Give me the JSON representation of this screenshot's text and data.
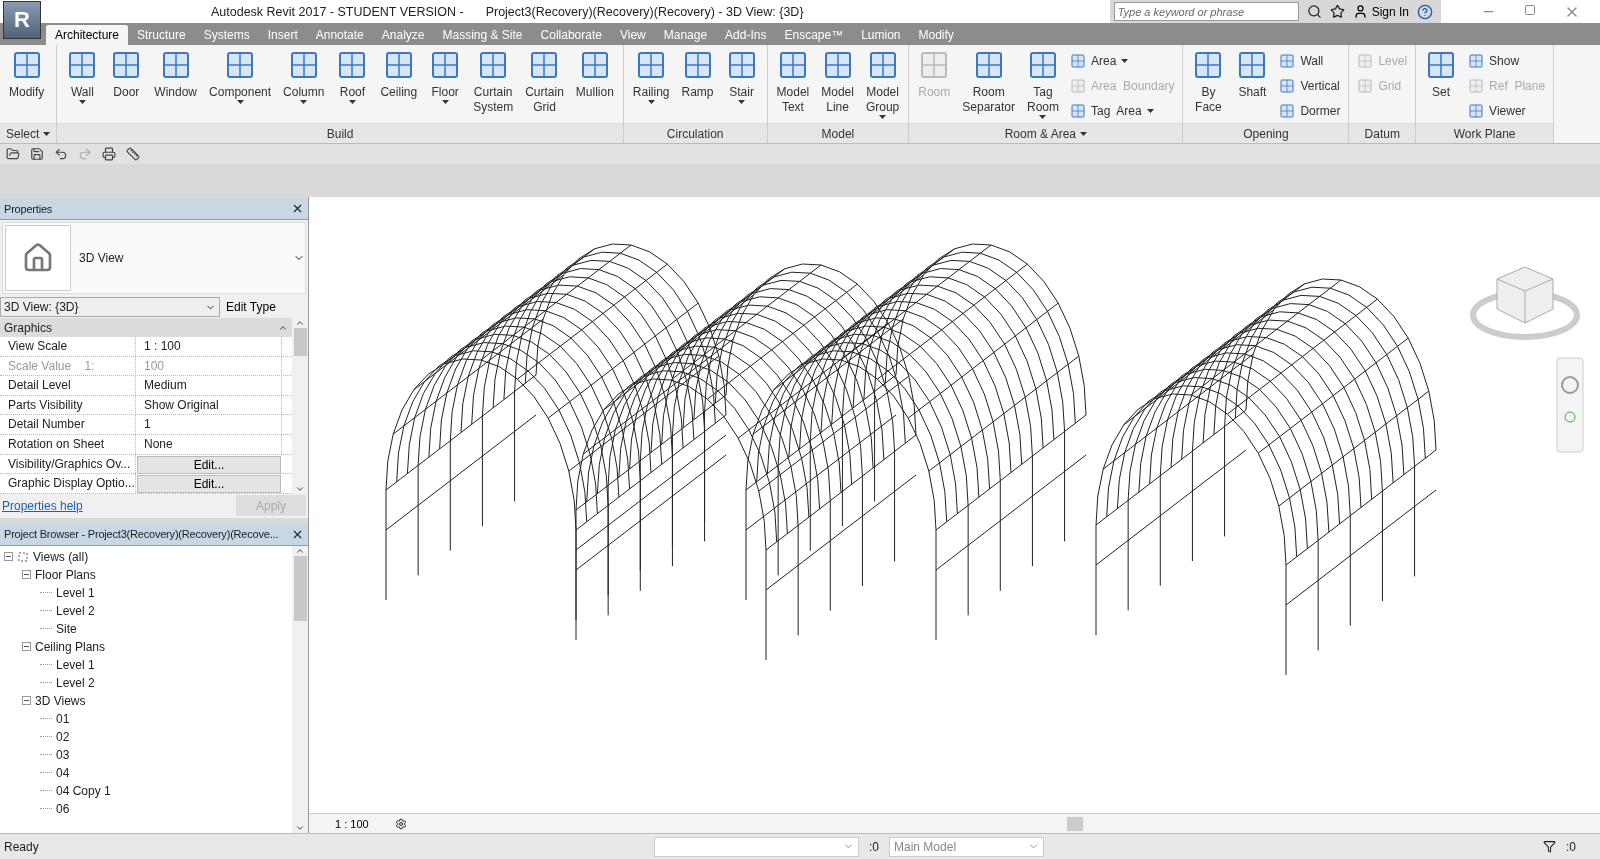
{
  "app_button": {
    "label": "R"
  },
  "title_bar": {
    "title": "Autodesk Revit 2017 - STUDENT VERSION -",
    "document": "Project3(Recovery)(Recovery)(Recovery) - 3D View: {3D}",
    "search": {
      "placeholder": "Type a keyword or phrase"
    },
    "sign_in": "Sign In"
  },
  "ribbon_tabs": [
    {
      "label": "Architecture",
      "selected": true
    },
    {
      "label": "Structure",
      "selected": false
    },
    {
      "label": "Systems",
      "selected": false
    },
    {
      "label": "Insert",
      "selected": false
    },
    {
      "label": "Annotate",
      "selected": false
    },
    {
      "label": "Analyze",
      "selected": false
    },
    {
      "label": "Massing & Site",
      "selected": false
    },
    {
      "label": "Collaborate",
      "selected": false
    },
    {
      "label": "View",
      "selected": false
    },
    {
      "label": "Manage",
      "selected": false
    },
    {
      "label": "Add-Ins",
      "selected": false
    },
    {
      "label": "Enscape™",
      "selected": false
    },
    {
      "label": "Lumion",
      "selected": false
    },
    {
      "label": "Modify",
      "selected": false
    }
  ],
  "ribbon_panels": [
    {
      "title": "Select",
      "menu": true,
      "tools": [
        {
          "label": "Modify",
          "kind": "large",
          "dropdown": false,
          "disabled": false
        }
      ]
    },
    {
      "title": "Build",
      "menu": false,
      "tools": [
        {
          "label": "Wall",
          "kind": "large",
          "dropdown": true,
          "disabled": false
        },
        {
          "label": "Door",
          "kind": "large",
          "dropdown": false,
          "disabled": false
        },
        {
          "label": "Window",
          "kind": "large",
          "dropdown": false,
          "disabled": false
        },
        {
          "label": "Component",
          "kind": "large",
          "dropdown": true,
          "disabled": false
        },
        {
          "label": "Column",
          "kind": "large",
          "dropdown": true,
          "disabled": false
        },
        {
          "label": "Roof",
          "kind": "large",
          "dropdown": true,
          "disabled": false
        },
        {
          "label": "Ceiling",
          "kind": "large",
          "dropdown": false,
          "disabled": false
        },
        {
          "label": "Floor",
          "kind": "large",
          "dropdown": true,
          "disabled": false
        },
        {
          "label": "Curtain System",
          "kind": "large",
          "dropdown": false,
          "disabled": false
        },
        {
          "label": "Curtain Grid",
          "kind": "large",
          "dropdown": false,
          "disabled": false
        },
        {
          "label": "Mullion",
          "kind": "large",
          "dropdown": false,
          "disabled": false
        }
      ]
    },
    {
      "title": "Circulation",
      "menu": false,
      "tools": [
        {
          "label": "Railing",
          "kind": "large",
          "dropdown": true,
          "disabled": false
        },
        {
          "label": "Ramp",
          "kind": "large",
          "dropdown": false,
          "disabled": false
        },
        {
          "label": "Stair",
          "kind": "large",
          "dropdown": true,
          "disabled": false
        }
      ]
    },
    {
      "title": "Model",
      "menu": false,
      "tools": [
        {
          "label": "Model Text",
          "kind": "large",
          "dropdown": false,
          "disabled": false
        },
        {
          "label": "Model Line",
          "kind": "large",
          "dropdown": false,
          "disabled": false
        },
        {
          "label": "Model Group",
          "kind": "large",
          "dropdown": true,
          "disabled": false
        }
      ]
    },
    {
      "title": "Room & Area",
      "menu": true,
      "tools": [
        {
          "label": "Room",
          "kind": "large",
          "dropdown": false,
          "disabled": true
        },
        {
          "label": "Room Separator",
          "kind": "large",
          "dropdown": false,
          "disabled": false
        },
        {
          "label": "Tag Room",
          "kind": "large",
          "dropdown": true,
          "disabled": false
        },
        {
          "label": "Area",
          "kind": "small",
          "dropdown": true,
          "disabled": false
        },
        {
          "label": "Area  Boundary",
          "kind": "small",
          "dropdown": false,
          "disabled": true
        },
        {
          "label": "Tag  Area",
          "kind": "small",
          "dropdown": true,
          "disabled": false
        }
      ]
    },
    {
      "title": "Opening",
      "menu": false,
      "tools": [
        {
          "label": "By Face",
          "kind": "large",
          "dropdown": false,
          "disabled": false
        },
        {
          "label": "Shaft",
          "kind": "large",
          "dropdown": false,
          "disabled": false
        },
        {
          "label": "Wall",
          "kind": "small",
          "dropdown": false,
          "disabled": false
        },
        {
          "label": "Vertical",
          "kind": "small",
          "dropdown": false,
          "disabled": false
        },
        {
          "label": "Dormer",
          "kind": "small",
          "dropdown": false,
          "disabled": false
        }
      ]
    },
    {
      "title": "Datum",
      "menu": false,
      "tools": [
        {
          "label": "Level",
          "kind": "small",
          "dropdown": false,
          "disabled": true
        },
        {
          "label": "Grid",
          "kind": "small",
          "dropdown": false,
          "disabled": true
        }
      ]
    },
    {
      "title": "Work Plane",
      "menu": false,
      "tools": [
        {
          "label": "Set",
          "kind": "large",
          "dropdown": false,
          "disabled": false
        },
        {
          "label": "Show",
          "kind": "small",
          "dropdown": false,
          "disabled": false
        },
        {
          "label": "Ref  Plane",
          "kind": "small",
          "dropdown": false,
          "disabled": true
        },
        {
          "label": "Viewer",
          "kind": "small",
          "dropdown": false,
          "disabled": false
        }
      ]
    }
  ],
  "properties": {
    "title": "Properties",
    "type_name": "3D View",
    "view_selector": "3D View: {3D}",
    "edit_type": "Edit Type",
    "group": "Graphics",
    "rows": [
      {
        "name": "View Scale",
        "value": "1 : 100",
        "kind": "text",
        "disabled": false
      },
      {
        "name": "Scale Value    1:",
        "value": "100",
        "kind": "text",
        "disabled": true
      },
      {
        "name": "Detail Level",
        "value": "Medium",
        "kind": "text",
        "disabled": false
      },
      {
        "name": "Parts Visibility",
        "value": "Show Original",
        "kind": "text",
        "disabled": false
      },
      {
        "name": "Detail Number",
        "value": "1",
        "kind": "text",
        "disabled": false
      },
      {
        "name": "Rotation on Sheet",
        "value": "None",
        "kind": "text",
        "disabled": false
      },
      {
        "name": "Visibility/Graphics Ov...",
        "value": "Edit...",
        "kind": "button",
        "disabled": false
      },
      {
        "name": "Graphic Display Optio...",
        "value": "Edit...",
        "kind": "button",
        "disabled": false
      }
    ],
    "help_link": "Properties help",
    "apply": {
      "label": "Apply",
      "disabled": true
    }
  },
  "project_browser": {
    "title": "Project Browser - Project3(Recovery)(Recovery)(Recove...",
    "tree": [
      {
        "label": "Views (all)",
        "expanded": true,
        "children": [
          {
            "label": "Floor Plans",
            "expanded": true,
            "children": [
              {
                "label": "Level 1"
              },
              {
                "label": "Level 2"
              },
              {
                "label": "Site"
              }
            ]
          },
          {
            "label": "Ceiling Plans",
            "expanded": true,
            "children": [
              {
                "label": "Level 1"
              },
              {
                "label": "Level 2"
              }
            ]
          },
          {
            "label": "3D Views",
            "expanded": true,
            "children": [
              {
                "label": "01"
              },
              {
                "label": "02"
              },
              {
                "label": "03"
              },
              {
                "label": "04"
              },
              {
                "label": "04 Copy 1"
              },
              {
                "label": "06"
              }
            ]
          }
        ]
      }
    ]
  },
  "view": {
    "scale": "1 : 100"
  },
  "status_bar": {
    "message": "Ready",
    "workset_count": ":0",
    "design_option": "Main Model",
    "filter_count": ":0"
  }
}
